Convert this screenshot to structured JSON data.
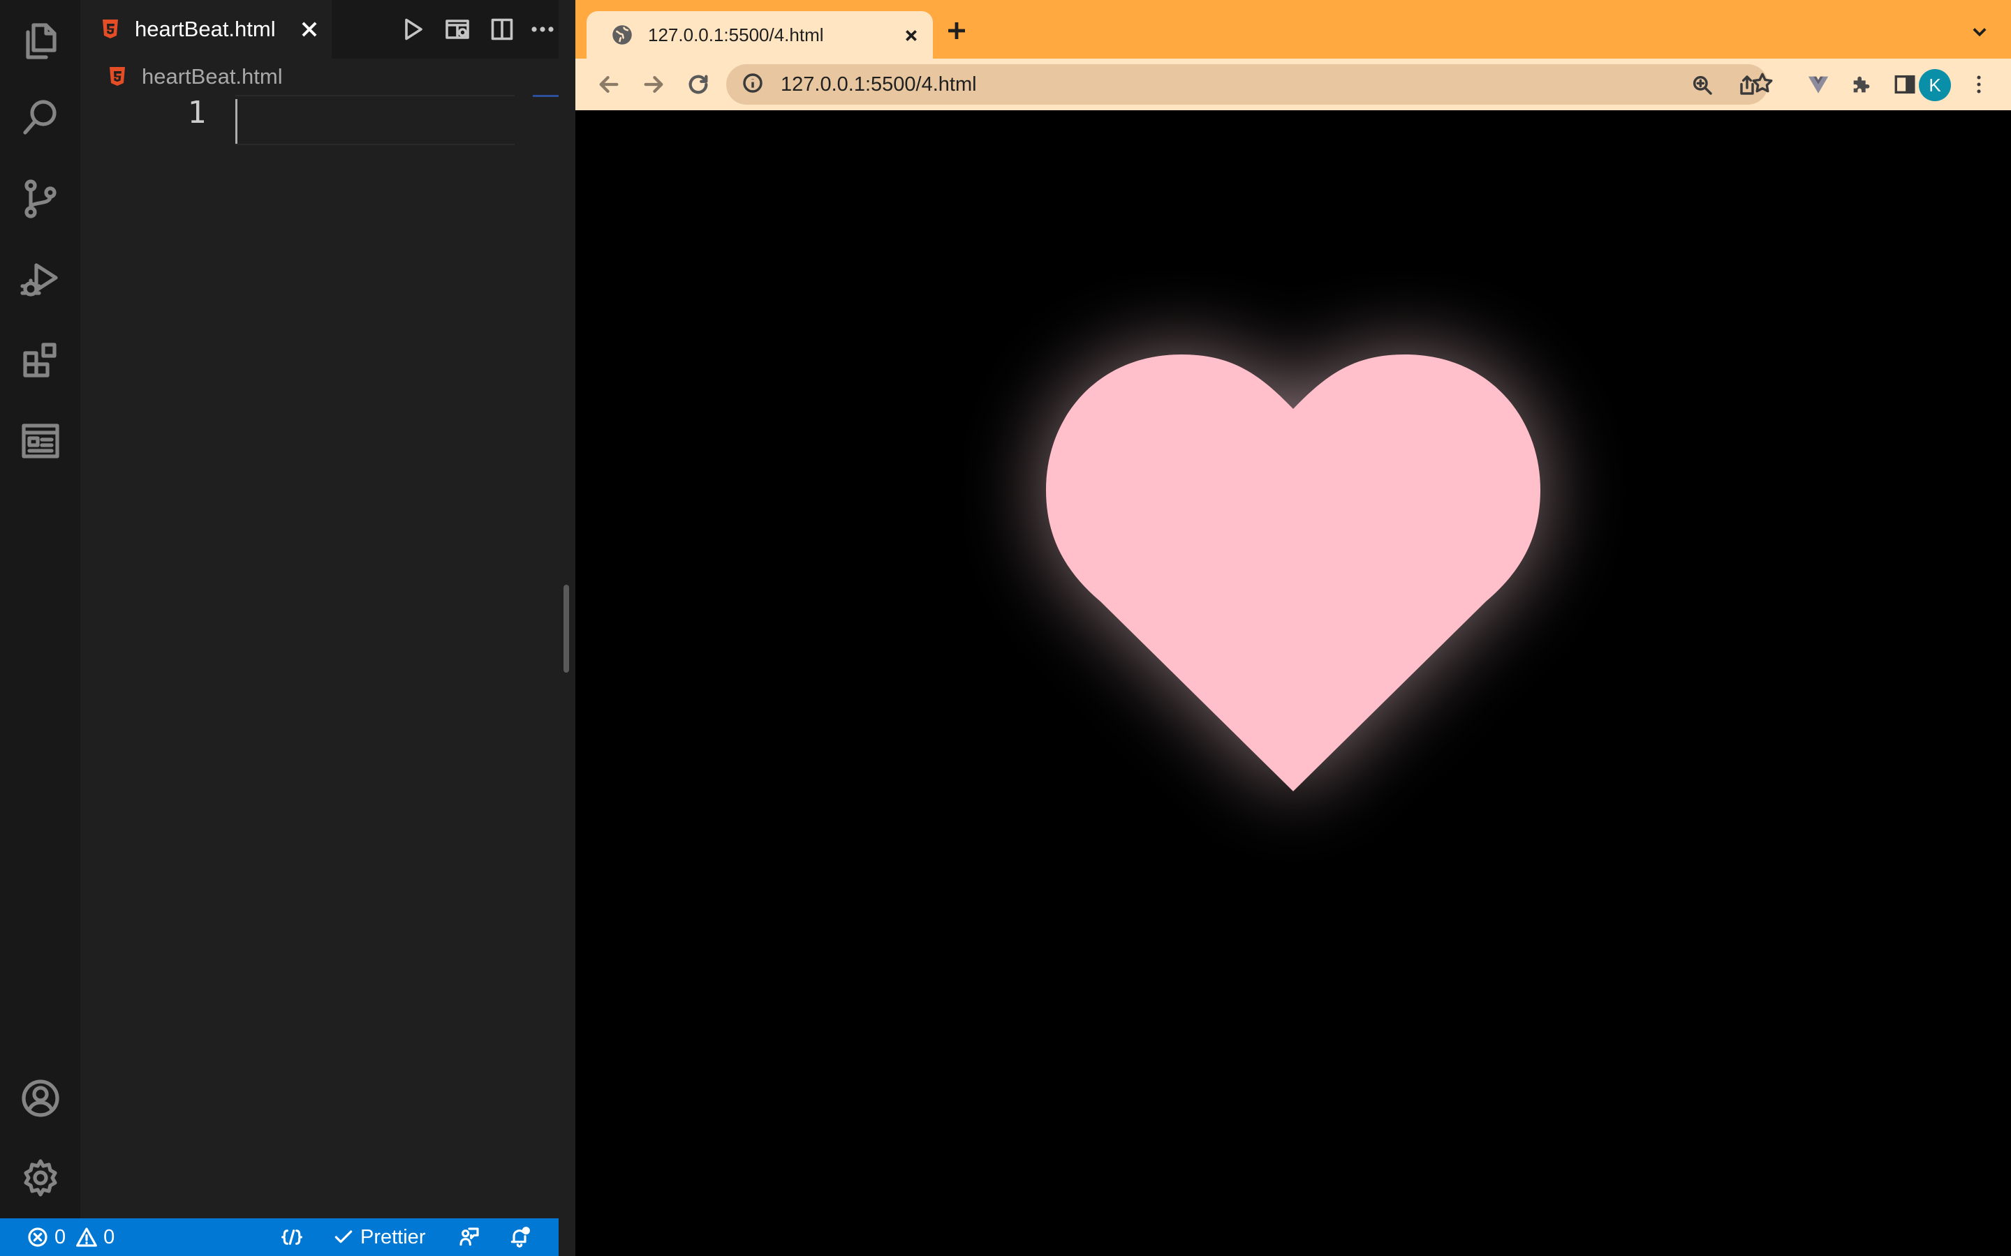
{
  "editor": {
    "tab_title": "heartBeat.html",
    "breadcrumb": "heartBeat.html",
    "line_number": "1"
  },
  "status_bar": {
    "errors": "0",
    "warnings": "0",
    "prettier": "Prettier"
  },
  "browser": {
    "tab_title": "127.0.0.1:5500/4.html",
    "url": "127.0.0.1:5500/4.html",
    "profile_initial": "K"
  },
  "colors": {
    "titlebar": "#ffa940",
    "toolbar": "#ffe5c2",
    "heart": "#ffc0cb",
    "status_bar": "#0078d4"
  }
}
